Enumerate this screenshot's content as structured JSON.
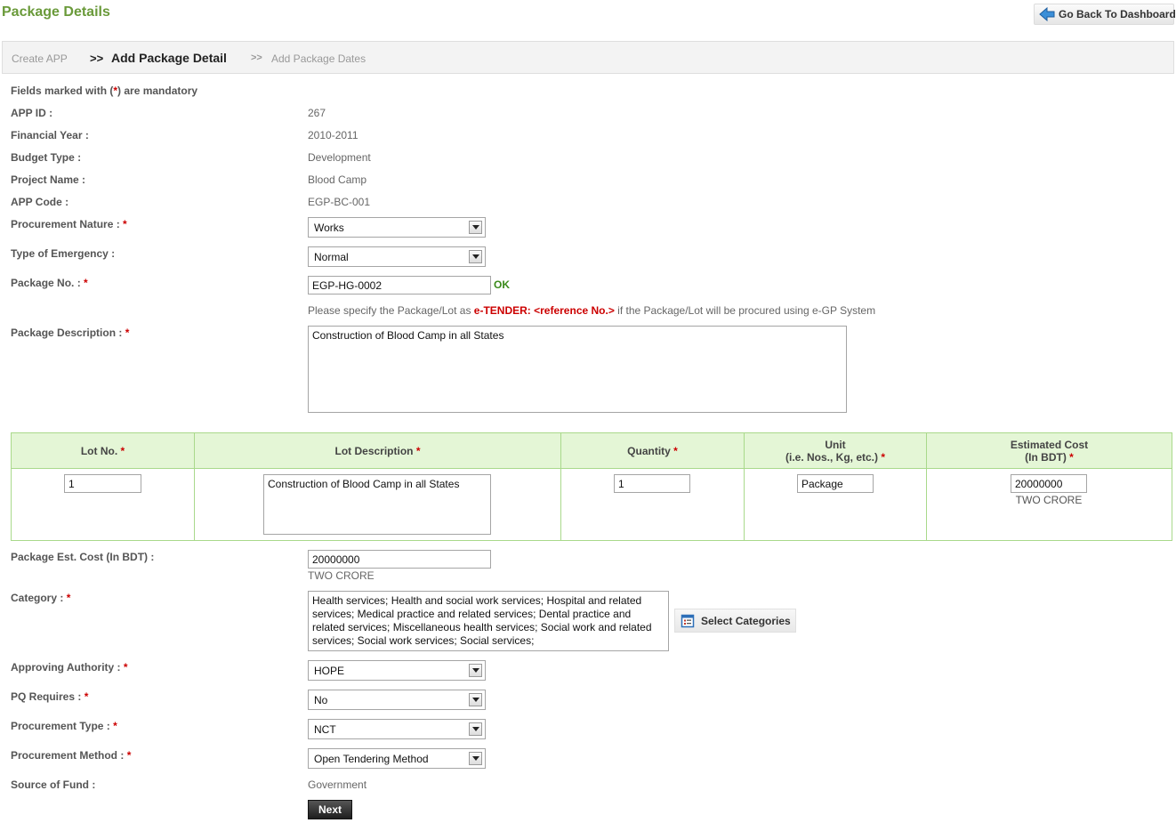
{
  "header": {
    "title": "Package Details",
    "back_button_label": "Go Back To Dashboard"
  },
  "steps": {
    "create_app": "Create APP",
    "sep1": ">>",
    "add_package_detail": "Add Package Detail",
    "sep2": ">>",
    "add_package_dates": "Add Package Dates"
  },
  "form": {
    "mandatory_note_pre": "Fields marked with (",
    "mandatory_note_star": "*",
    "mandatory_note_post": ") are mandatory",
    "required_mark": "*",
    "app_id_label": "APP ID :",
    "app_id_value": "267",
    "financial_year_label": "Financial Year :",
    "financial_year_value": "2010-2011",
    "budget_type_label": "Budget Type :",
    "budget_type_value": "Development",
    "project_name_label": "Project Name :",
    "project_name_value": "Blood Camp",
    "app_code_label": "APP Code :",
    "app_code_value": "EGP-BC-001",
    "procurement_nature_label": "Procurement Nature :",
    "procurement_nature_value": "Works",
    "type_of_emergency_label": "Type of Emergency :",
    "type_of_emergency_value": "Normal",
    "package_no_label": "Package No. :",
    "package_no_value": "EGP-HG-0002",
    "package_no_status": "OK",
    "hint_pre": "Please specify the Package/Lot as ",
    "hint_highlight": "e-TENDER: <reference No.>",
    "hint_post": " if the Package/Lot will be procured using e-GP System",
    "package_description_label": "Package Description :",
    "package_description_value": "Construction of Blood Camp in all States",
    "package_est_cost_label": "Package Est. Cost (In BDT) :",
    "package_est_cost_value": "20000000",
    "package_est_cost_words": "TWO CRORE",
    "category_label": "Category :",
    "category_value": "Health services; Health and social work services; Hospital and related services; Medical practice and related services; Dental practice and related services; Miscellaneous health services; Social work and related services; Social work services; Social services;",
    "select_categories_label": "Select Categories",
    "approving_authority_label": "Approving Authority :",
    "approving_authority_value": "HOPE",
    "pq_requires_label": "PQ Requires :",
    "pq_requires_value": "No",
    "procurement_type_label": "Procurement Type :",
    "procurement_type_value": "NCT",
    "procurement_method_label": "Procurement Method :",
    "procurement_method_value": "Open Tendering Method",
    "source_of_fund_label": "Source of Fund :",
    "source_of_fund_value": "Government",
    "next_label": "Next"
  },
  "lot_table": {
    "headers": {
      "lot_no": "Lot No.",
      "lot_description": "Lot Description",
      "quantity": "Quantity",
      "unit_line1": "Unit",
      "unit_line2": "(i.e. Nos., Kg, etc.)",
      "est_cost_line1": "Estimated Cost",
      "est_cost_line2": "(In BDT)"
    },
    "row": {
      "lot_no": "1",
      "lot_description": "Construction of Blood Camp in all States",
      "quantity": "1",
      "unit": "Package",
      "est_cost": "20000000",
      "est_cost_words": "TWO CRORE"
    }
  },
  "colors": {
    "title_green": "#6a9a3a",
    "required_red": "#cc0000",
    "ok_green": "#3a8a1a",
    "table_header_bg": "#e4f6d6",
    "table_border": "#a9d98b"
  },
  "icons": {
    "back": "back-arrow-icon",
    "categories": "calendar-list-icon",
    "dropdown": "chevron-down-icon"
  }
}
